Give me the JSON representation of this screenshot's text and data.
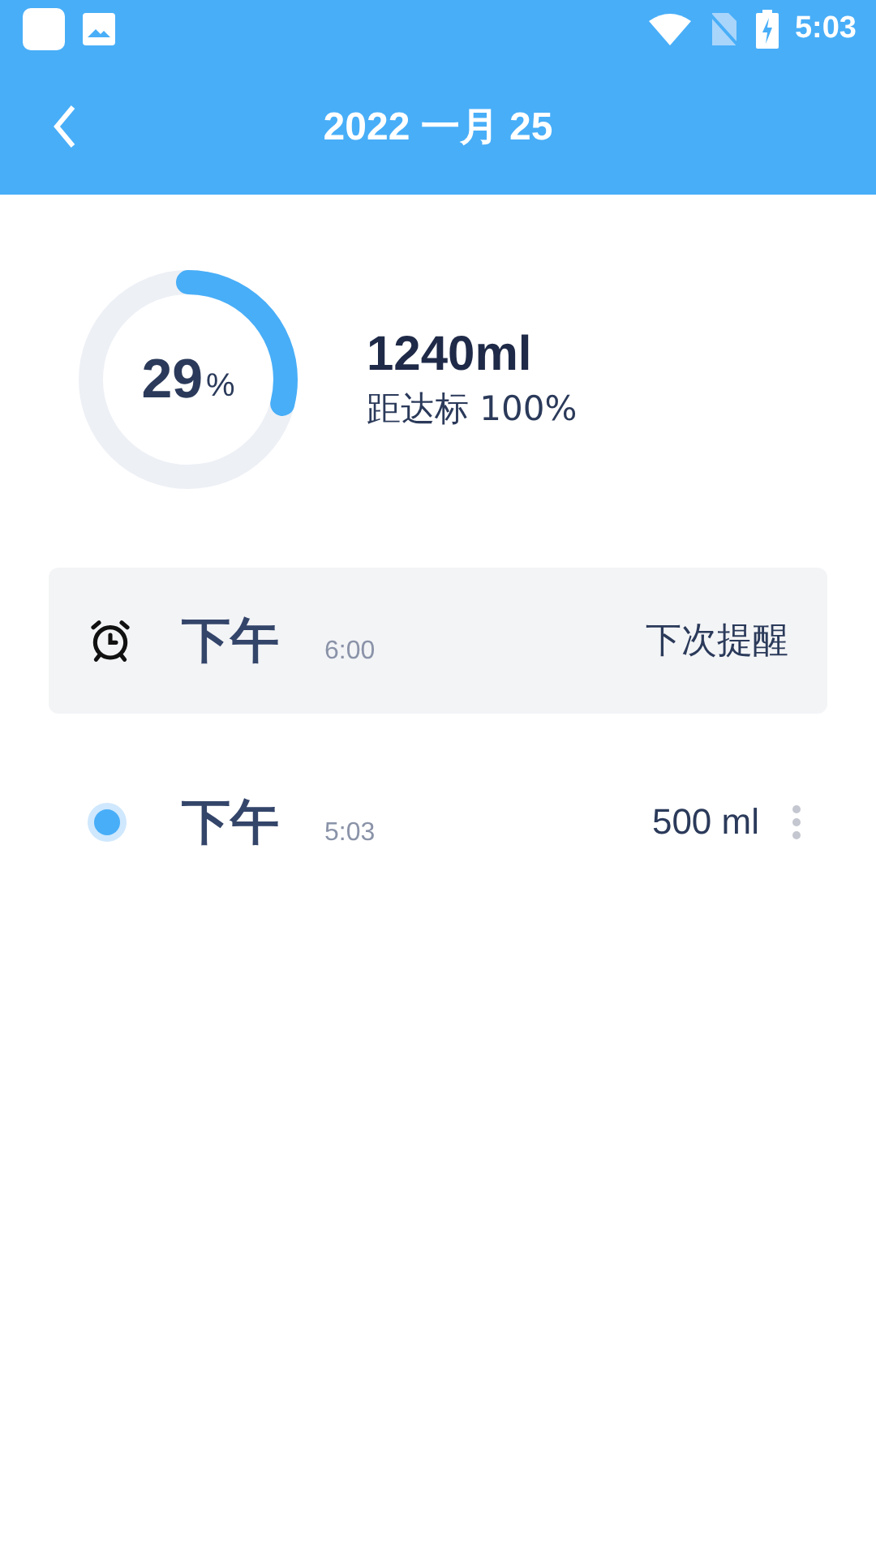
{
  "status_bar": {
    "time": "5:03"
  },
  "header": {
    "title": "2022 一月 25"
  },
  "progress": {
    "percent": "29",
    "percent_sign": "%",
    "amount": "1240ml",
    "goal_label": "距达标 100%"
  },
  "entries": [
    {
      "kind": "reminder",
      "period": "下午",
      "time": "6:00",
      "note": "下次提醒"
    },
    {
      "kind": "log",
      "period": "下午",
      "time": "5:03",
      "note": "500 ml"
    }
  ]
}
